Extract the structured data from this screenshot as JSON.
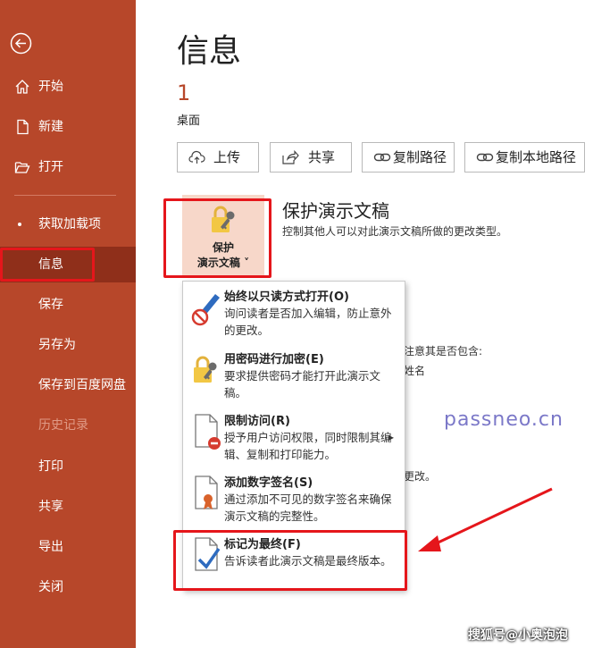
{
  "sidebar": {
    "items": [
      {
        "label": "开始",
        "icon": "home-icon"
      },
      {
        "label": "新建",
        "icon": "new-document-icon"
      },
      {
        "label": "打开",
        "icon": "folder-open-icon"
      },
      {
        "label": "获取加载项"
      },
      {
        "label": "信息",
        "active": true
      },
      {
        "label": "保存"
      },
      {
        "label": "另存为"
      },
      {
        "label": "保存到百度网盘"
      },
      {
        "label": "历史记录",
        "disabled": true
      },
      {
        "label": "打印"
      },
      {
        "label": "共享"
      },
      {
        "label": "导出"
      },
      {
        "label": "关闭"
      }
    ]
  },
  "main": {
    "title": "信息",
    "doc_number": "1",
    "location": "桌面",
    "buttons": [
      {
        "label": "上传",
        "icon": "cloud-upload-icon"
      },
      {
        "label": "共享",
        "icon": "share-icon"
      },
      {
        "label": "复制路径",
        "icon": "link-icon"
      },
      {
        "label": "复制本地路径",
        "icon": "link-icon"
      }
    ],
    "protect": {
      "tile_line1": "保护",
      "tile_line2": "演示文稿 ˅",
      "heading": "保护演示文稿",
      "description": "控制其他人可以对此演示文稿所做的更改类型。"
    },
    "background_text": {
      "line1": "注意其是否包含:",
      "line2": "姓名",
      "line3": "更改。"
    },
    "watermark": "passneo.cn"
  },
  "menu": {
    "items": [
      {
        "title": "始终以只读方式打开(O)",
        "desc": "询问读者是否加入编辑，防止意外的更改。",
        "icon": "pencil-no-icon"
      },
      {
        "title": "用密码进行加密(E)",
        "desc": "要求提供密码才能打开此演示文稿。",
        "icon": "lock-key-icon"
      },
      {
        "title": "限制访问(R)",
        "desc": "授予用户访问权限，同时限制其编辑、复制和打印能力。",
        "icon": "restrict-access-icon",
        "submenu": "▸"
      },
      {
        "title": "添加数字签名(S)",
        "desc": "通过添加不可见的数字签名来确保演示文稿的完整性。",
        "icon": "signature-ribbon-icon"
      },
      {
        "title": "标记为最终(F)",
        "desc": "告诉读者此演示文稿是最终版本。",
        "icon": "mark-final-icon"
      }
    ]
  },
  "credit": "搜狐号@小奥泡泡",
  "colors": {
    "sidebar": "#b7472a",
    "active": "#8f2f1a",
    "highlight": "#e5161b",
    "tile": "#f7d7c9",
    "watermark": "#7b78c8"
  }
}
